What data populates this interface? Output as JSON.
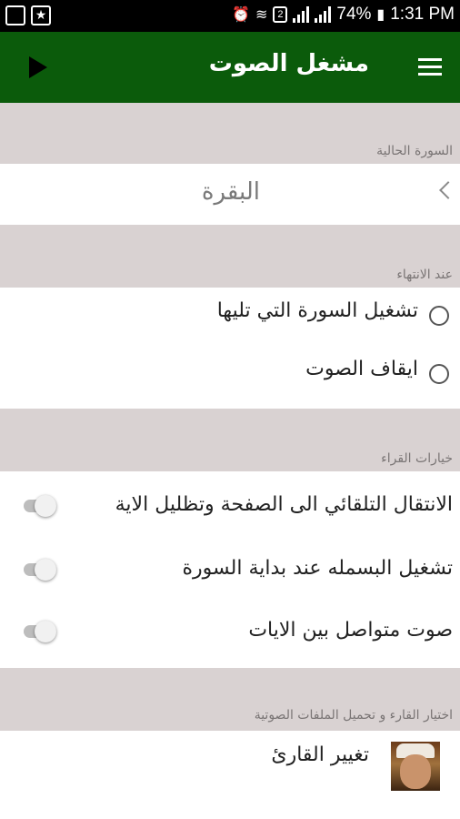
{
  "status_bar": {
    "battery": "74%",
    "time": "1:31 PM",
    "icons": [
      "screen-icon",
      "star-icon",
      "alarm-icon",
      "wifi-icon",
      "sim-2-icon",
      "signal-icon",
      "signal-icon-2",
      "battery-icon"
    ]
  },
  "app_bar": {
    "title": "مشغل الصوت",
    "play_icon": "play-icon",
    "menu_icon": "menu-icon"
  },
  "current_surah": {
    "label": "السورة الحالية",
    "value": "البقرة"
  },
  "on_end": {
    "label": "عند الانتهاء",
    "options": [
      {
        "label": "تشغيل السورة التي تليها",
        "selected": false
      },
      {
        "label": "ايقاف الصوت",
        "selected": false
      }
    ]
  },
  "reader_options": {
    "label": "خيارات القراء",
    "toggles": [
      {
        "label": "الانتقال التلقائي الى الصفحة وتظليل الاية",
        "on": false
      },
      {
        "label": "تشغيل البسمله عند بداية السورة",
        "on": false
      },
      {
        "label": "صوت متواصل بين الايات",
        "on": false
      }
    ]
  },
  "reader_select": {
    "label": "اختيار القارء و تحميل الملفات الصوتية",
    "change_reader": "تغيير القارئ"
  },
  "colors": {
    "app_bar": "#0b5b0b",
    "background": "#d9d2d2"
  }
}
